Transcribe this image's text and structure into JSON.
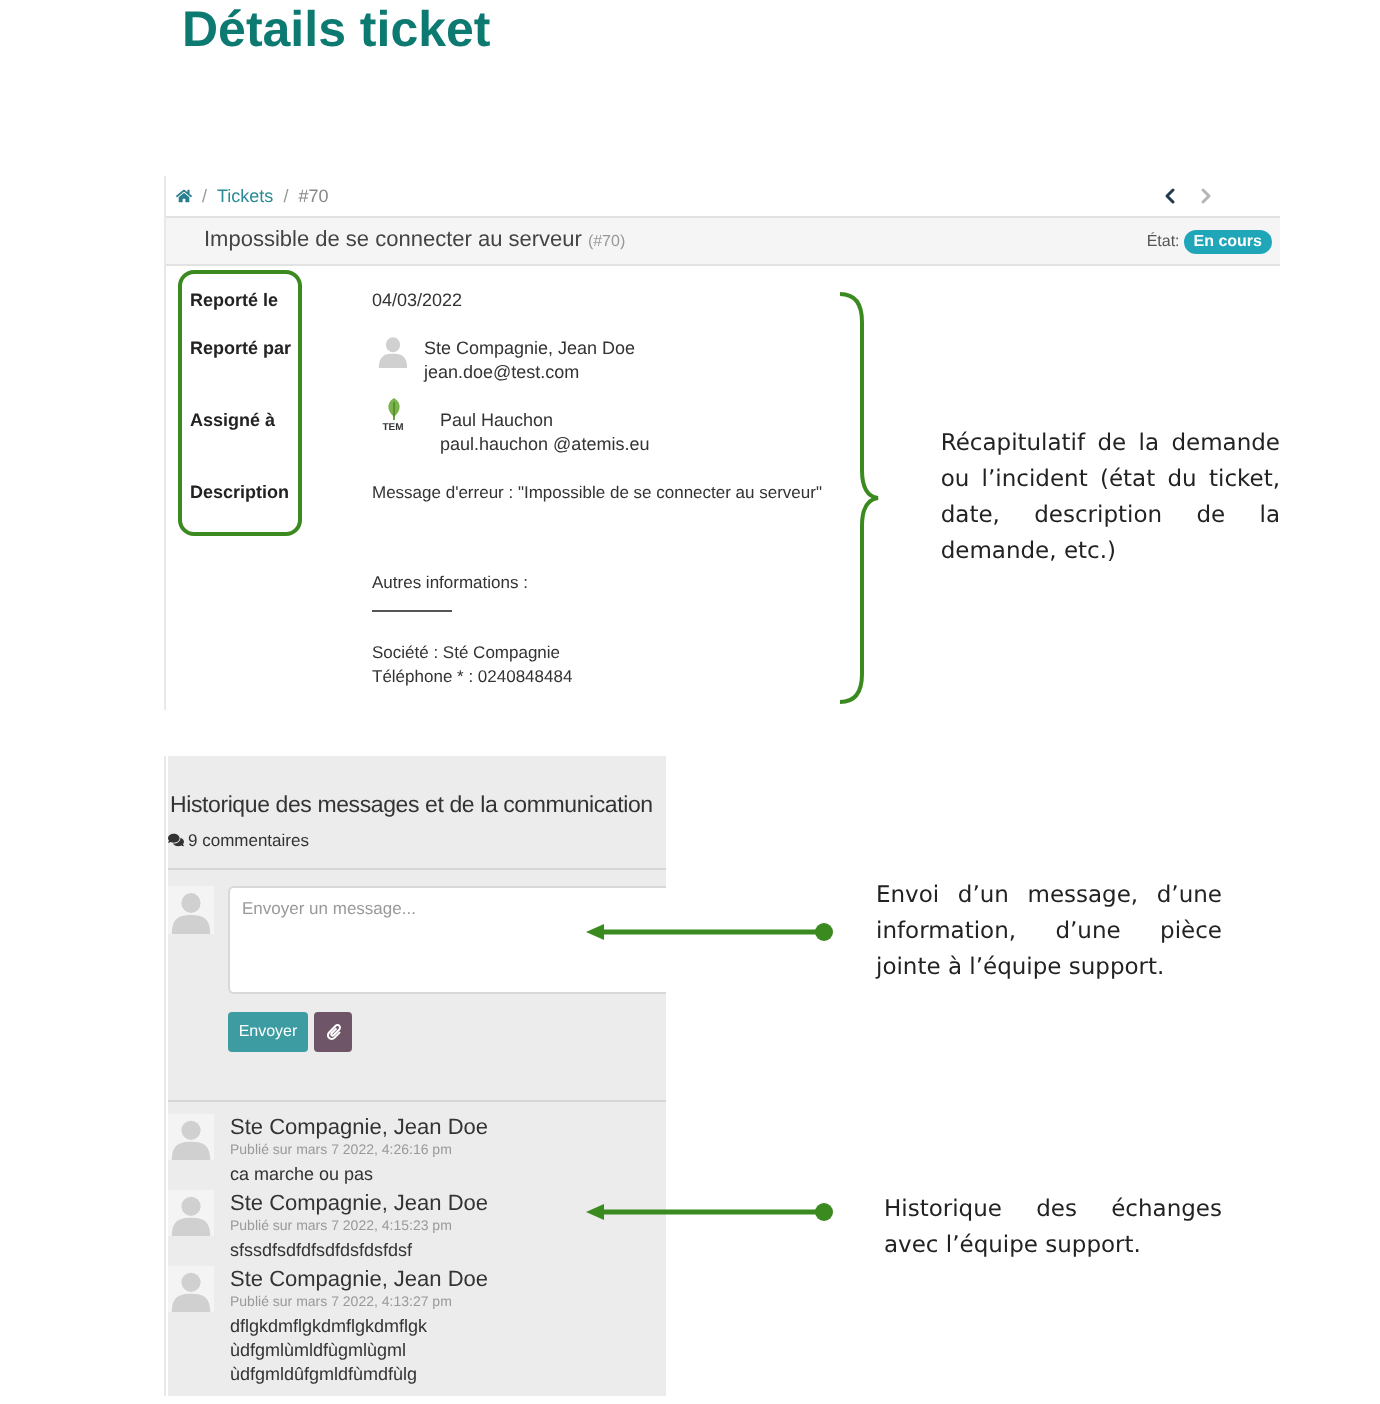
{
  "page_title": "Détails ticket",
  "breadcrumb": {
    "separator": "/",
    "items": [
      {
        "kind": "home"
      },
      {
        "kind": "link",
        "label": "Tickets"
      },
      {
        "kind": "current",
        "label": "#70"
      }
    ]
  },
  "pager": [
    {
      "kind": "previous",
      "disabled": false
    },
    {
      "kind": "next",
      "disabled": true
    }
  ],
  "ticket": {
    "title": "Impossible de se connecter au serveur",
    "number": "(#70)",
    "state_label": "État:",
    "state": "En cours"
  },
  "details": [
    {
      "label": "Reporté le",
      "kind": "text",
      "value": "04/03/2022"
    },
    {
      "label": "Reporté par",
      "kind": "person",
      "avatar": {
        "kind": "silhouette"
      },
      "name": "Ste Compagnie, Jean Doe",
      "email": "jean.doe@test.com"
    },
    {
      "label": "Assigné à",
      "kind": "person",
      "avatar": {
        "kind": "logo",
        "text": "TEM"
      },
      "name": "Paul Hauchon",
      "email": "paul.hauchon @atemis.eu"
    },
    {
      "label": "Description",
      "kind": "description",
      "paragraphs": [
        {
          "lines": [
            "Message d'erreur : \"Impossible de se connecter au serveur\""
          ],
          "rule": false
        },
        {
          "lines": [
            "Autres informations :"
          ],
          "rule": true
        },
        {
          "lines": [
            "Société : Sté Compagnie",
            "Téléphone * : 0240848484"
          ],
          "rule": false
        }
      ]
    }
  ],
  "summary_note": "Récapitulatif de la demande ou l’incident (état du ticket, date, description de la demande, etc.)",
  "history": {
    "title": "Historique des messages et de la communication",
    "count": "9 commentaires",
    "composer": {
      "placeholder": "Envoyer un message...",
      "send_label": "Envoyer"
    },
    "comments": [
      {
        "author": "Ste Compagnie, Jean Doe",
        "date": "Publié sur mars 7 2022, 4:26:16 pm",
        "lines": [
          "ca marche ou pas"
        ]
      },
      {
        "author": "Ste Compagnie, Jean Doe",
        "date": "Publié sur mars 7 2022, 4:15:23 pm",
        "lines": [
          "sfssdfsdfdfsdfdsfdsfdsf"
        ]
      },
      {
        "author": "Ste Compagnie, Jean Doe",
        "date": "Publié sur mars 7 2022, 4:13:27 pm",
        "lines": [
          "dflgkdmflgkdmflgkdmflgk",
          "ùdfgmlùmldfùgmlùgml",
          "ùdfgmldûfgmldfùmdfùlg"
        ]
      }
    ]
  },
  "notes": [
    {
      "text": "Envoi d’un message, d’une information, d’une pièce jointe à l’équipe support."
    },
    {
      "text": "Historique des échanges avec l’équipe support."
    }
  ]
}
